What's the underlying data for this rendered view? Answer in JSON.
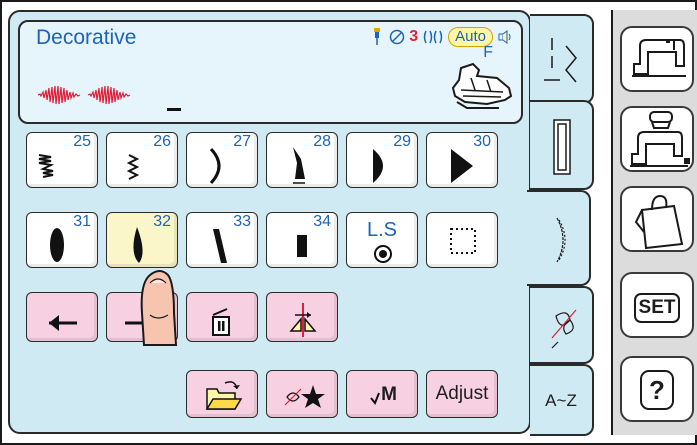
{
  "display": {
    "title": "Decorative",
    "thread_count": "3",
    "auto_label": "Auto",
    "foot_letter": "F"
  },
  "patterns": [
    {
      "number": "25",
      "icon": "zigzag-step-stitch-icon"
    },
    {
      "number": "26",
      "icon": "zigzag-stitch-icon"
    },
    {
      "number": "27",
      "icon": "crescent-stitch-icon"
    },
    {
      "number": "28",
      "icon": "slanted-satin-stitch-icon"
    },
    {
      "number": "29",
      "icon": "half-moon-satin-icon"
    },
    {
      "number": "30",
      "icon": "triangle-satin-icon"
    },
    {
      "number": "31",
      "icon": "oval-satin-icon"
    },
    {
      "number": "32",
      "icon": "teardrop-satin-icon",
      "selected": true
    },
    {
      "number": "33",
      "icon": "diagonal-satin-icon"
    },
    {
      "number": "34",
      "icon": "block-satin-icon"
    }
  ],
  "ls_button": {
    "label": "L.S"
  },
  "action_buttons": {
    "adjust_label": "Adjust",
    "memory_label": "M"
  },
  "tabs": {
    "alphabet_label": "A~Z"
  },
  "right_column": {
    "set_label": "SET",
    "help_label": "?"
  },
  "colors": {
    "panel": "#cfeaf3",
    "display": "#e6f5fb",
    "text_blue": "#1d63b8",
    "pink_button": "#f7d1e2",
    "selected": "#fbf6c9",
    "stitch_red": "#e0203a"
  }
}
